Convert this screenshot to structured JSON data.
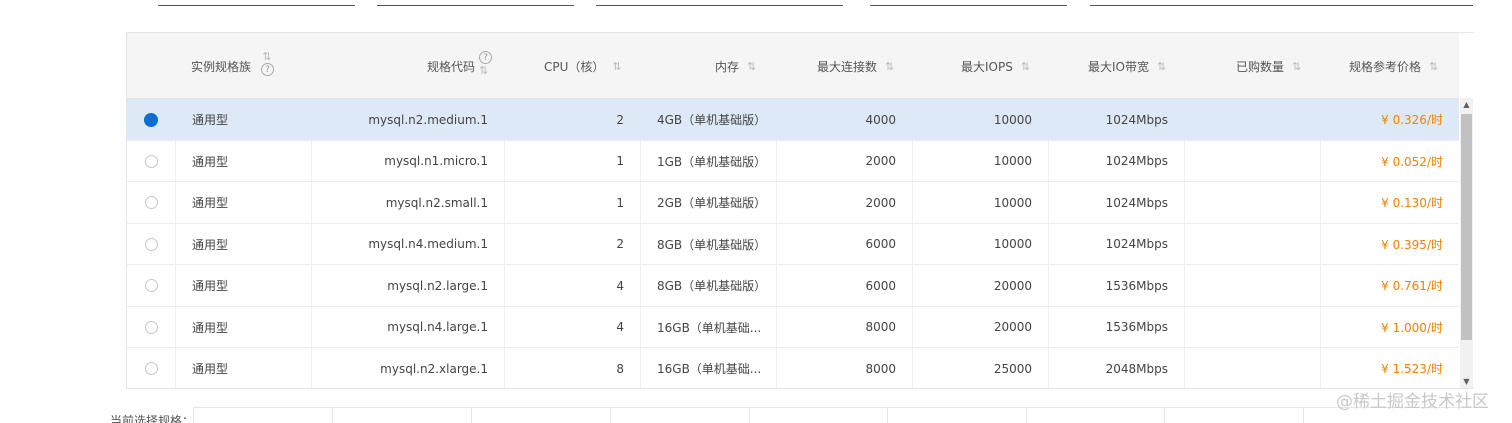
{
  "table": {
    "columns": [
      {
        "label": "实例规格族",
        "help": "?",
        "sortable": true
      },
      {
        "label": "规格代码",
        "help": "?",
        "sortable": true
      },
      {
        "label": "CPU（核）",
        "sortable": true
      },
      {
        "label": "内存",
        "sortable": true
      },
      {
        "label": "最大连接数",
        "sortable": true
      },
      {
        "label": "最大IOPS",
        "sortable": true
      },
      {
        "label": "最大IO带宽",
        "sortable": true
      },
      {
        "label": "已购数量",
        "sortable": true
      },
      {
        "label": "规格参考价格",
        "sortable": true
      }
    ],
    "rows": [
      {
        "selected": true,
        "family": "通用型",
        "code": "mysql.n2.medium.1",
        "cpu": "2",
        "memory": "4GB（单机基础版）",
        "conn": "4000",
        "iops": "10000",
        "bw": "1024Mbps",
        "bought": "",
        "price": "¥ 0.326/时"
      },
      {
        "selected": false,
        "family": "通用型",
        "code": "mysql.n1.micro.1",
        "cpu": "1",
        "memory": "1GB（单机基础版）",
        "conn": "2000",
        "iops": "10000",
        "bw": "1024Mbps",
        "bought": "",
        "price": "¥ 0.052/时"
      },
      {
        "selected": false,
        "family": "通用型",
        "code": "mysql.n2.small.1",
        "cpu": "1",
        "memory": "2GB（单机基础版）",
        "conn": "2000",
        "iops": "10000",
        "bw": "1024Mbps",
        "bought": "",
        "price": "¥ 0.130/时"
      },
      {
        "selected": false,
        "family": "通用型",
        "code": "mysql.n4.medium.1",
        "cpu": "2",
        "memory": "8GB（单机基础版）",
        "conn": "6000",
        "iops": "10000",
        "bw": "1024Mbps",
        "bought": "",
        "price": "¥ 0.395/时"
      },
      {
        "selected": false,
        "family": "通用型",
        "code": "mysql.n2.large.1",
        "cpu": "4",
        "memory": "8GB（单机基础版）",
        "conn": "6000",
        "iops": "20000",
        "bw": "1536Mbps",
        "bought": "",
        "price": "¥ 0.761/时"
      },
      {
        "selected": false,
        "family": "通用型",
        "code": "mysql.n4.large.1",
        "cpu": "4",
        "memory": "16GB（单机基础...",
        "conn": "8000",
        "iops": "20000",
        "bw": "1536Mbps",
        "bought": "",
        "price": "¥ 1.000/时"
      },
      {
        "selected": false,
        "family": "通用型",
        "code": "mysql.n2.xlarge.1",
        "cpu": "8",
        "memory": "16GB（单机基础...",
        "conn": "8000",
        "iops": "25000",
        "bw": "2048Mbps",
        "bought": "",
        "price": "¥ 1.523/时"
      }
    ]
  },
  "scrollbar": {
    "up_icon": "▲",
    "down_icon": "▼"
  },
  "bottom": {
    "label": "当前选择规格："
  },
  "watermark": "@稀土掘金技术社区",
  "colors": {
    "selected_row": "#dde9f6",
    "radio_on": "#0b6fd1",
    "price": "#f08200",
    "header_bg": "#f5f5f5"
  }
}
